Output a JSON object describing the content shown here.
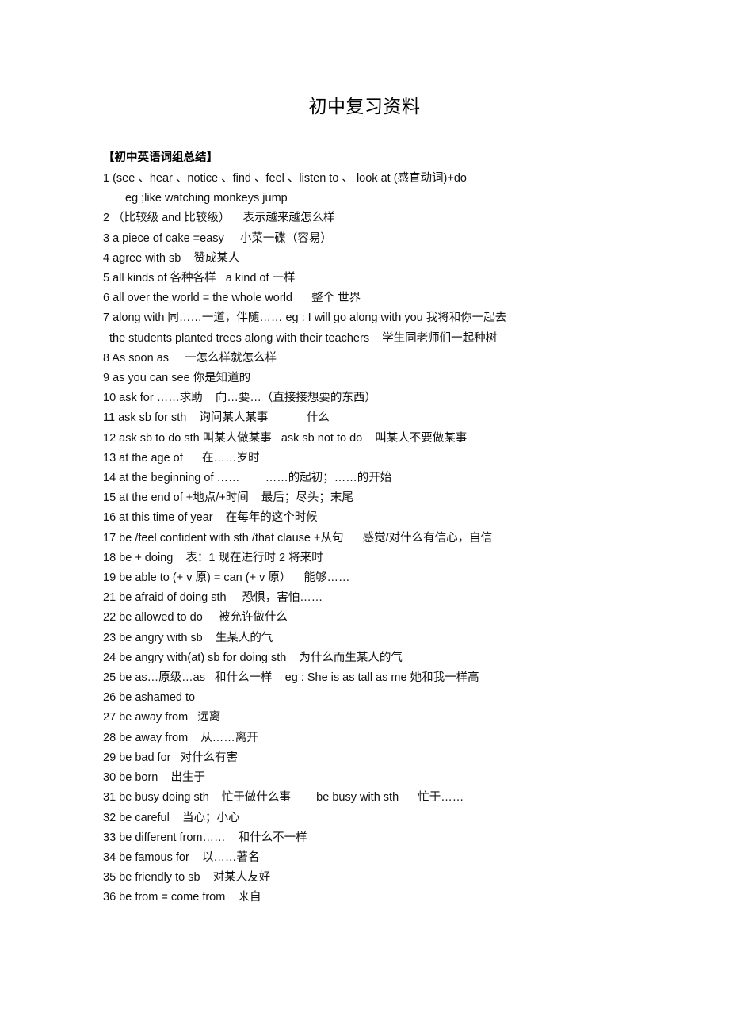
{
  "document": {
    "title": "初中复习资料",
    "section_heading": "【初中英语词组总结】"
  },
  "entries": [
    {
      "n": "1",
      "indent": "none",
      "text": "1 (see 、hear 、notice 、find 、feel 、listen to 、 look at (感官动词)+do"
    },
    {
      "n": "1b",
      "indent": "one",
      "text": "eg ;like watching monkeys jump"
    },
    {
      "n": "2",
      "indent": "none",
      "text": "2 （比较级 and 比较级）    表示越来越怎么样"
    },
    {
      "n": "3",
      "indent": "none",
      "text": "3 a piece of cake =easy     小菜一碟（容易）"
    },
    {
      "n": "4",
      "indent": "none",
      "text": "4 agree with sb    赞成某人"
    },
    {
      "n": "5",
      "indent": "none",
      "text": "5 all kinds of 各种各样   a kind of 一样"
    },
    {
      "n": "6",
      "indent": "none",
      "text": "6 all over the world = the whole world      整个 世界"
    },
    {
      "n": "7",
      "indent": "none",
      "text": "7 along with 同……一道，伴随…… eg : I will go along with you 我将和你一起去"
    },
    {
      "n": "7b",
      "indent": "two",
      "text": "the students planted trees along with their teachers    学生同老师们一起种树"
    },
    {
      "n": "8",
      "indent": "none",
      "text": "8 As soon as     一怎么样就怎么样"
    },
    {
      "n": "9",
      "indent": "none",
      "text": "9 as you can see 你是知道的"
    },
    {
      "n": "10",
      "indent": "none",
      "text": "10 ask for ……求助    向…要…（直接接想要的东西）"
    },
    {
      "n": "11",
      "indent": "none",
      "text": "11 ask sb for sth    询问某人某事            什么"
    },
    {
      "n": "12",
      "indent": "none",
      "text": "12 ask sb to do sth 叫某人做某事   ask sb not to do    叫某人不要做某事"
    },
    {
      "n": "13",
      "indent": "none",
      "text": "13 at the age of      在……岁时"
    },
    {
      "n": "14",
      "indent": "none",
      "text": "14 at the beginning of ……        ……的起初；……的开始"
    },
    {
      "n": "15",
      "indent": "none",
      "text": "15 at the end of +地点/+时间    最后；尽头；末尾"
    },
    {
      "n": "16",
      "indent": "none",
      "text": "16 at this time of year    在每年的这个时候"
    },
    {
      "n": "17",
      "indent": "none",
      "text": "17 be /feel confident with sth /that clause +从句      感觉/对什么有信心，自信"
    },
    {
      "n": "18",
      "indent": "none",
      "text": "18 be + doing    表：1 现在进行时 2 将来时"
    },
    {
      "n": "19",
      "indent": "none",
      "text": "19 be able to (+ v 原) = can (+ v 原）    能够……"
    },
    {
      "n": "21",
      "indent": "none",
      "text": "21 be afraid of doing sth     恐惧，害怕……"
    },
    {
      "n": "22",
      "indent": "none",
      "text": "22 be allowed to do     被允许做什么"
    },
    {
      "n": "23",
      "indent": "none",
      "text": "23 be angry with sb    生某人的气"
    },
    {
      "n": "24",
      "indent": "none",
      "text": "24 be angry with(at) sb for doing sth    为什么而生某人的气"
    },
    {
      "n": "25",
      "indent": "none",
      "text": "25 be as…原级…as   和什么一样    eg : She is as tall as me 她和我一样高"
    },
    {
      "n": "26",
      "indent": "none",
      "text": "26 be ashamed to"
    },
    {
      "n": "27",
      "indent": "none",
      "text": "27 be away from   远离"
    },
    {
      "n": "28",
      "indent": "none",
      "text": "28 be away from    从……离开"
    },
    {
      "n": "29",
      "indent": "none",
      "text": "29 be bad for   对什么有害"
    },
    {
      "n": "30",
      "indent": "none",
      "text": "30 be born    出生于"
    },
    {
      "n": "31",
      "indent": "none",
      "text": "31 be busy doing sth    忙于做什么事        be busy with sth      忙于……"
    },
    {
      "n": "32",
      "indent": "none",
      "text": "32 be careful    当心；小心"
    },
    {
      "n": "33",
      "indent": "none",
      "text": "33 be different from……    和什么不一样"
    },
    {
      "n": "34",
      "indent": "none",
      "text": "34 be famous for    以……著名"
    },
    {
      "n": "35",
      "indent": "none",
      "text": "35 be friendly to sb    对某人友好"
    },
    {
      "n": "36",
      "indent": "none",
      "text": "36 be from = come from    来自"
    }
  ]
}
